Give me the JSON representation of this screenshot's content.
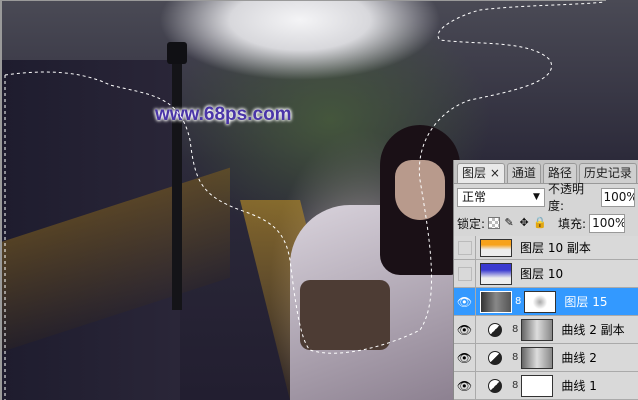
{
  "watermark": "www.68ps.com",
  "panel": {
    "tabs": [
      {
        "label": "图层 ×",
        "active": true
      },
      {
        "label": "通道"
      },
      {
        "label": "路径"
      },
      {
        "label": "历史记录"
      }
    ],
    "blend_mode": "正常",
    "opacity_label": "不透明度:",
    "opacity": "100%",
    "lock_label": "锁定:",
    "fill_label": "填充:",
    "fill": "100%",
    "layers": [
      {
        "name": "图层 10 副本",
        "visible": false
      },
      {
        "name": "图层 10",
        "visible": false
      },
      {
        "name": "图层 15",
        "visible": true,
        "selected": true
      },
      {
        "name": "曲线 2 副本",
        "visible": true
      },
      {
        "name": "曲线 2",
        "visible": true
      },
      {
        "name": "曲线 1",
        "visible": true
      }
    ]
  }
}
